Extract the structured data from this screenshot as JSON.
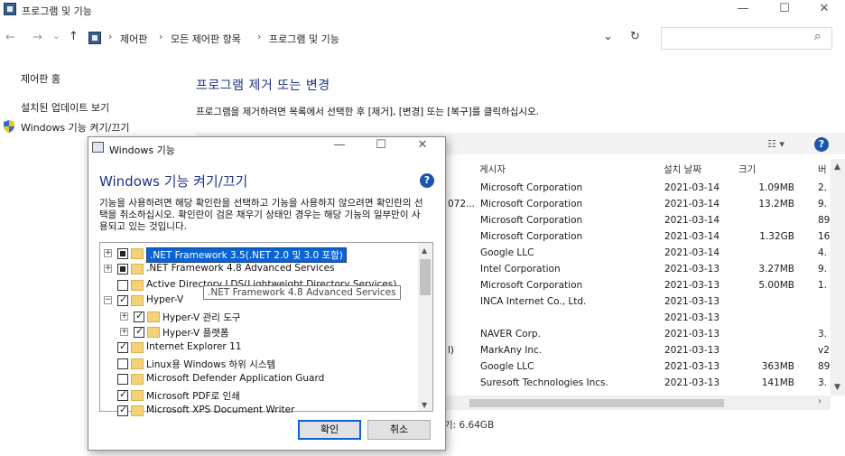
{
  "window": {
    "title": "프로그램 및 기능",
    "minimize": "—",
    "maximize": "☐",
    "close": "✕"
  },
  "address": {
    "crumbs": [
      "제어판",
      "모든 제어판 항목",
      "프로그램 및 기능"
    ],
    "sep": "›",
    "back": "←",
    "forward": "→",
    "dropdown": "⌄",
    "up": "↑",
    "refresh": "↻",
    "search_icon": "⌕"
  },
  "left_panel": {
    "home": "제어판 홈",
    "updates": "설치된 업데이트 보기",
    "features": "Windows 기능 켜기/끄기"
  },
  "main": {
    "title": "프로그램 제거 또는 변경",
    "description": "프로그램을 제거하려면 목록에서 선택한 후 [제거], [변경] 또는 [복구]를 클릭하십시오.",
    "view_icon": "☷ ▾",
    "help": "?"
  },
  "list": {
    "columns": {
      "publisher": "게시자",
      "installed": "설치 날짜",
      "size": "크기",
      "version": "버"
    },
    "rows": [
      {
        "name_tail": "",
        "publisher": "Microsoft Corporation",
        "date": "2021-03-14",
        "size": "1.09MB",
        "version": "2."
      },
      {
        "name_tail": "072...",
        "publisher": "Microsoft Corporation",
        "date": "2021-03-14",
        "size": "13.2MB",
        "version": "9."
      },
      {
        "name_tail": "",
        "publisher": "Microsoft Corporation",
        "date": "2021-03-14",
        "size": "",
        "version": "89"
      },
      {
        "name_tail": "",
        "publisher": "Microsoft Corporation",
        "date": "2021-03-14",
        "size": "1.32GB",
        "version": "16"
      },
      {
        "name_tail": "",
        "publisher": "Google LLC",
        "date": "2021-03-14",
        "size": "",
        "version": "4."
      },
      {
        "name_tail": "",
        "publisher": "Intel Corporation",
        "date": "2021-03-13",
        "size": "3.27MB",
        "version": "9."
      },
      {
        "name_tail": "",
        "publisher": "Microsoft Corporation",
        "date": "2021-03-13",
        "size": "5.00MB",
        "version": "1."
      },
      {
        "name_tail": "",
        "publisher": "INCA Internet Co., Ltd.",
        "date": "2021-03-13",
        "size": "",
        "version": ""
      },
      {
        "name_tail": "",
        "publisher": "",
        "date": "2021-03-13",
        "size": "",
        "version": ""
      },
      {
        "name_tail": "",
        "publisher": "NAVER Corp.",
        "date": "2021-03-13",
        "size": "",
        "version": "3."
      },
      {
        "name_tail": "l)",
        "publisher": "MarkAny Inc.",
        "date": "2021-03-13",
        "size": "",
        "version": "v2"
      },
      {
        "name_tail": "",
        "publisher": "Google LLC",
        "date": "2021-03-13",
        "size": "363MB",
        "version": "89"
      },
      {
        "name_tail": "",
        "publisher": "Suresoft Technologies Incs.",
        "date": "2021-03-13",
        "size": "141MB",
        "version": "3."
      }
    ],
    "summary_size": "기: 6.64GB"
  },
  "dialog": {
    "title": "Windows 기능",
    "heading": "Windows 기능 켜기/끄기",
    "description": "기능을 사용하려면 해당 확인란을 선택하고 기능을 사용하지 않으려면 확인란의 선택을 취소하십시오. 확인란이 검은 채우기 상태인 경우는 해당 기능의 일부만이 사용되고 있는 것입니다.",
    "help": "?",
    "minimize": "—",
    "maximize": "☐",
    "close": "✕",
    "items": [
      {
        "label": ".NET Framework 3.5(.NET 2.0 및 3.0 포함)",
        "state": "partial",
        "expandable": true,
        "level": 0,
        "selected": true
      },
      {
        "label": ".NET Framework 4.8 Advanced Services",
        "state": "partial",
        "expandable": true,
        "level": 0
      },
      {
        "label": "Active Directory LDS(Lightweight Directory Services)",
        "state": "none",
        "expandable": false,
        "level": 0
      },
      {
        "label": "Hyper-V",
        "state": "full",
        "expandable": true,
        "level": 0,
        "expanded": true
      },
      {
        "label": "Hyper-V 관리 도구",
        "state": "full",
        "expandable": true,
        "level": 1
      },
      {
        "label": "Hyper-V 플랫폼",
        "state": "full",
        "expandable": true,
        "level": 1
      },
      {
        "label": "Internet Explorer 11",
        "state": "full",
        "expandable": false,
        "level": 0
      },
      {
        "label": "Linux용 Windows 하위 시스템",
        "state": "none",
        "expandable": false,
        "level": 0
      },
      {
        "label": "Microsoft Defender Application Guard",
        "state": "none",
        "expandable": false,
        "level": 0
      },
      {
        "label": "Microsoft PDF로 인쇄",
        "state": "full",
        "expandable": false,
        "level": 0
      },
      {
        "label": "Microsoft XPS Document Writer",
        "state": "full",
        "expandable": false,
        "level": 0
      }
    ],
    "tooltip": ".NET Framework 4.8 Advanced Services",
    "ok": "확인",
    "cancel": "취소"
  }
}
